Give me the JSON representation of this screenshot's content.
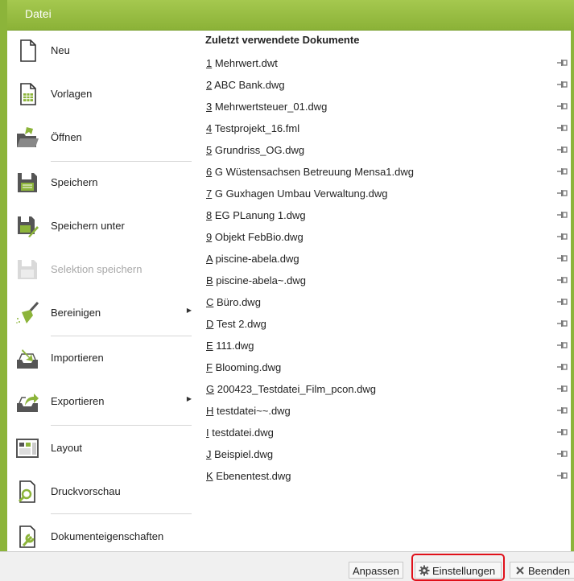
{
  "window": {
    "title": "Datei"
  },
  "colors": {
    "accent": "#8cb43a",
    "highlight": "#e0101a",
    "disabled": "#a8a8a8"
  },
  "menu": {
    "items": [
      {
        "label": "Neu",
        "icon": "new-document-icon"
      },
      {
        "label": "Vorlagen",
        "icon": "templates-icon"
      },
      {
        "label": "Öffnen",
        "icon": "open-folder-icon"
      },
      {
        "label": "Speichern",
        "icon": "save-icon"
      },
      {
        "label": "Speichern unter",
        "icon": "save-as-icon"
      },
      {
        "label": "Selektion speichern",
        "icon": "save-selection-icon",
        "disabled": true
      },
      {
        "label": "Bereinigen",
        "icon": "broom-icon",
        "submenu": true
      },
      {
        "label": "Importieren",
        "icon": "import-icon"
      },
      {
        "label": "Exportieren",
        "icon": "export-icon",
        "submenu": true
      },
      {
        "label": "Layout",
        "icon": "layout-icon"
      },
      {
        "label": "Druckvorschau",
        "icon": "print-preview-icon"
      },
      {
        "label": "Dokumenteigenschaften",
        "icon": "document-properties-icon"
      }
    ]
  },
  "recent": {
    "header": "Zuletzt verwendete Dokumente",
    "items": [
      {
        "key": "1",
        "name": " Mehrwert.dwt"
      },
      {
        "key": "2",
        "name": " ABC Bank.dwg"
      },
      {
        "key": "3",
        "name": " Mehrwertsteuer_01.dwg"
      },
      {
        "key": "4",
        "name": " Testprojekt_16.fml"
      },
      {
        "key": "5",
        "name": " Grundriss_OG.dwg"
      },
      {
        "key": "6",
        "name": " G Wüstensachsen Betreuung Mensa1.dwg"
      },
      {
        "key": "7",
        "name": " G Guxhagen Umbau Verwaltung.dwg"
      },
      {
        "key": "8",
        "name": " EG PLanung 1.dwg"
      },
      {
        "key": "9",
        "name": " Objekt FebBio.dwg"
      },
      {
        "key": "A",
        "name": " piscine-abela.dwg"
      },
      {
        "key": "B",
        "name": " piscine-abela~.dwg"
      },
      {
        "key": "C",
        "name": " Büro.dwg"
      },
      {
        "key": "D",
        "name": " Test 2.dwg"
      },
      {
        "key": "E",
        "name": " 111.dwg"
      },
      {
        "key": "F",
        "name": " Blooming.dwg"
      },
      {
        "key": "G",
        "name": " 200423_Testdatei_Film_pcon.dwg"
      },
      {
        "key": "H",
        "name": " testdatei~~.dwg"
      },
      {
        "key": "I",
        "name": " testdatei.dwg"
      },
      {
        "key": "J",
        "name": " Beispiel.dwg"
      },
      {
        "key": "K",
        "name": " Ebenentest.dwg"
      }
    ]
  },
  "footer": {
    "customize_label": "Anpassen",
    "settings_label": "Einstellungen",
    "settings_icon": "gear-icon",
    "exit_label": "Beenden",
    "exit_icon": "close-icon"
  }
}
